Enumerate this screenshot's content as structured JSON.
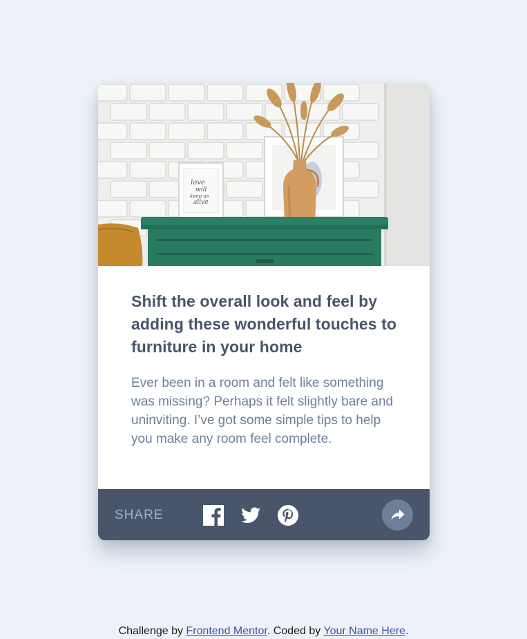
{
  "colors": {
    "page_bg": "#ecf2f8",
    "card_bg": "#ffffff",
    "title": "#48556a",
    "description": "#6e8098",
    "share_bar_bg": "#48556a",
    "share_label": "#9eafc2",
    "share_button_bg": "#6e8098",
    "link": "#3e52a3"
  },
  "article": {
    "title": "Shift the overall look and feel by adding these wonderful touches to furniture in your home",
    "description": "Ever been in a room and felt like something was missing? Perhaps it felt slightly bare and uninviting. I’ve got some simple tips to help you make any room feel complete."
  },
  "share": {
    "label": "SHARE",
    "icons": [
      "facebook-icon",
      "twitter-icon",
      "pinterest-icon",
      "share-arrow-icon"
    ]
  },
  "attribution": {
    "prefix": "Challenge by ",
    "challenge_link": "Frontend Mentor",
    "middle": ". Coded by ",
    "author_link": "Your Name Here",
    "suffix": "."
  }
}
